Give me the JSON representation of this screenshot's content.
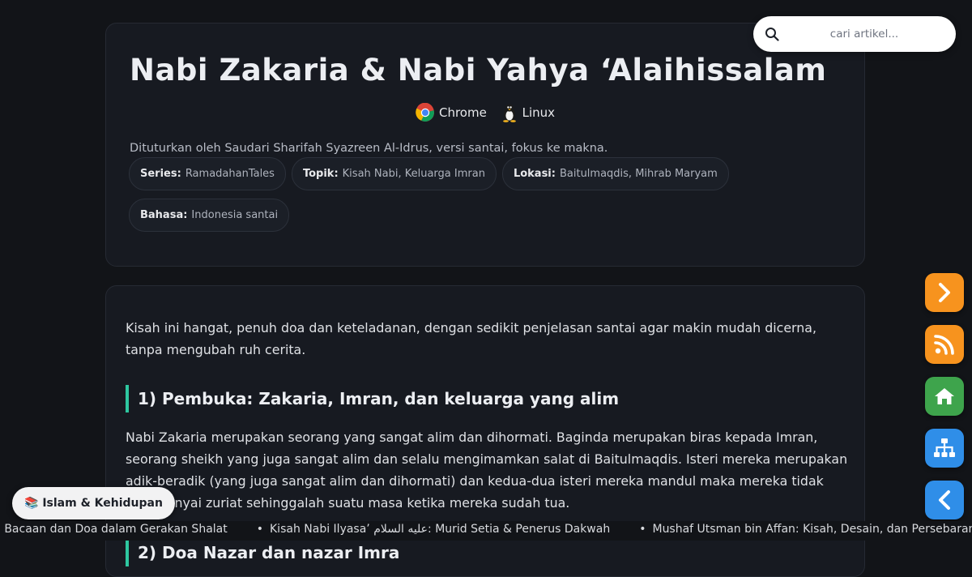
{
  "article": {
    "title": "Nabi Zakaria & Nabi Yahya ‘Alaihissalam",
    "platforms": [
      {
        "label": "Chrome",
        "icon": "chrome-icon"
      },
      {
        "label": "Linux",
        "icon": "linux-icon"
      }
    ],
    "byline": "Dituturkan oleh Saudari Sharifah Syazreen Al-Idrus, versi santai, fokus ke makna.",
    "chips": [
      {
        "key": "Series:",
        "value": "RamadahanTales"
      },
      {
        "key": "Topik:",
        "value": "Kisah Nabi, Keluarga Imran"
      },
      {
        "key": "Lokasi:",
        "value": "Baitulmaqdis, Mihrab Maryam"
      },
      {
        "key": "Bahasa:",
        "value": "Indonesia santai"
      }
    ]
  },
  "content": {
    "intro": "Kisah ini hangat, penuh doa dan keteladanan, dengan sedikit penjelasan santai agar makin mudah dicerna, tanpa mengubah ruh cerita.",
    "section1_heading": "1) Pembuka: Zakaria, Imran, dan keluarga yang alim",
    "section1_text": "Nabi Zakaria merupakan seorang yang sangat alim dan dihormati. Baginda merupakan biras kepada Imran, seorang sheikh yang juga sangat alim dan selalu mengimamkan salat di Baitulmaqdis. Isteri mereka merupakan adik-beradik (yang juga sangat alim dan dihormati) dan kedua-dua isteri mereka mandul maka mereka tidak mempunyai zuriat sehinggalah suatu masa ketika mereka sudah tua.",
    "section2_heading": "2) Doa Nazar dan nazar Imra"
  },
  "search": {
    "placeholder": "cari artikel..."
  },
  "floating_buttons": [
    {
      "name": "next-button",
      "icon": "chevron-right-icon",
      "color": "#f7931e"
    },
    {
      "name": "rss-button",
      "icon": "rss-icon",
      "color": "#f7931e"
    },
    {
      "name": "home-button",
      "icon": "home-icon",
      "color": "#3ea44c"
    },
    {
      "name": "sitemap-button",
      "icon": "sitemap-icon",
      "color": "#2f8ee8"
    },
    {
      "name": "back-button",
      "icon": "chevron-left-icon",
      "color": "#2f8ee8"
    }
  ],
  "category_pill": {
    "emoji": "📚",
    "label": "Islam & Kehidupan"
  },
  "ticker": [
    "n Bacaan dan Doa dalam Gerakan Shalat",
    "Kisah Nabi Ilyasa’ عليه السلام: Murid Setia & Penerus Dakwah",
    "Mushaf Utsman bin Affan: Kisah, Desain, dan Persebaran"
  ],
  "colors": {
    "accent": "#2ec7a0",
    "background": "#121418",
    "card": "#171a21"
  }
}
